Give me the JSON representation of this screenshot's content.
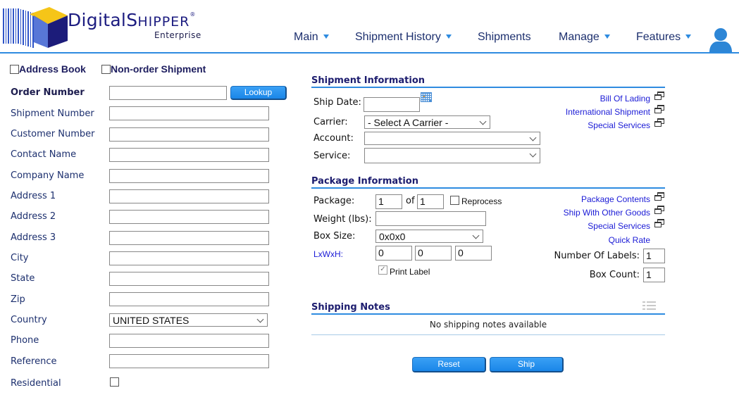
{
  "brand": {
    "name_part1": "Digital",
    "name_part2_initial": "S",
    "name_part2_rest": "HIPPER",
    "registered": "®",
    "edition": "Enterprise",
    "colors": {
      "accent": "#2e8be0",
      "navy": "#1c1c80",
      "logo_yellow": "#f5c518"
    }
  },
  "nav": {
    "items": [
      {
        "label": "Main",
        "dropdown": true
      },
      {
        "label": "Shipment History",
        "dropdown": true
      },
      {
        "label": "Shipments",
        "dropdown": false
      },
      {
        "label": "Manage",
        "dropdown": true
      },
      {
        "label": "Features",
        "dropdown": true
      }
    ],
    "user_icon": "user-icon"
  },
  "left": {
    "address_book_label": "Address Book",
    "address_book_checked": false,
    "non_order_label": "Non-order Shipment",
    "non_order_checked": false,
    "order_number_label": "Order Number",
    "order_number_value": "",
    "lookup_label": "Lookup",
    "fields": [
      {
        "label": "Shipment Number",
        "value": ""
      },
      {
        "label": "Customer Number",
        "value": ""
      },
      {
        "label": "Contact Name",
        "value": ""
      },
      {
        "label": "Company Name",
        "value": ""
      },
      {
        "label": "Address 1",
        "value": ""
      },
      {
        "label": "Address 2",
        "value": ""
      },
      {
        "label": "Address 3",
        "value": ""
      },
      {
        "label": "City",
        "value": ""
      },
      {
        "label": "State",
        "value": ""
      },
      {
        "label": "Zip",
        "value": ""
      }
    ],
    "country_label": "Country",
    "country_value": "UNITED STATES",
    "phone_label": "Phone",
    "phone_value": "",
    "reference_label": "Reference",
    "reference_value": "",
    "residential_label": "Residential",
    "residential_checked": false
  },
  "shipment": {
    "title": "Shipment Information",
    "ship_date_label": "Ship Date:",
    "ship_date_value": "",
    "carrier_label": "Carrier:",
    "carrier_value": "- Select A Carrier -",
    "account_label": "Account:",
    "account_value": "",
    "service_label": "Service:",
    "service_value": "",
    "links": [
      "Bill Of Lading",
      "International Shipment",
      "Special Services"
    ]
  },
  "package": {
    "title": "Package Information",
    "package_label": "Package:",
    "package_value": "1",
    "of_label": "of",
    "of_value": "1",
    "reprocess_label": "Reprocess",
    "reprocess_checked": false,
    "weight_label": "Weight (lbs):",
    "weight_value": "",
    "box_size_label": "Box Size:",
    "box_size_value": "0x0x0",
    "dims_label": "LxWxH:",
    "dims": [
      "0",
      "0",
      "0"
    ],
    "print_label_label": "Print Label",
    "print_label_checked": true,
    "links": [
      "Package Contents",
      "Ship With Other Goods",
      "Special Services"
    ],
    "quick_rate_label": "Quick Rate",
    "num_labels_label": "Number Of Labels:",
    "num_labels_value": "1",
    "box_count_label": "Box Count:",
    "box_count_value": "1"
  },
  "notes": {
    "title": "Shipping Notes",
    "empty_text": "No shipping notes available"
  },
  "actions": {
    "reset_label": "Reset",
    "ship_label": "Ship"
  }
}
